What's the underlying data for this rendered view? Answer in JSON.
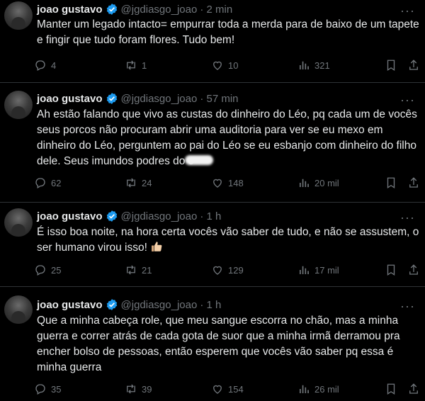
{
  "tweets": [
    {
      "name": "joao gustavo",
      "handle": "@jgdiasgo_joao",
      "time": "· 2 min",
      "text": "Manter um legado intacto= empurrar toda a merda para de baixo de um tapete e fingir que tudo foram flores. Tudo bem!",
      "text_tail": "",
      "replies": "4",
      "retweets": "1",
      "likes": "10",
      "views": "321"
    },
    {
      "name": "joao gustavo",
      "handle": "@jgdiasgo_joao",
      "time": "· 57 min",
      "text": "Ah estão falando que vivo as custas do dinheiro do Léo, pq cada um de vocês seus porcos não procuram abrir uma auditoria para ver se eu mexo em dinheiro do Léo, perguntem ao pai do Léo se eu esbanjo com dinheiro do filho dele. Seus imundos podres do c",
      "text_tail": "",
      "replies": "62",
      "retweets": "24",
      "likes": "148",
      "views": "20 mil"
    },
    {
      "name": "joao gustavo",
      "handle": "@jgdiasgo_joao",
      "time": "· 1 h",
      "text": "É isso boa noite, na hora certa vocês vão saber de tudo, e não se assustem, o ser humano virou isso! ",
      "text_tail": "",
      "replies": "25",
      "retweets": "21",
      "likes": "129",
      "views": "17 mil"
    },
    {
      "name": "joao gustavo",
      "handle": "@jgdiasgo_joao",
      "time": "· 1 h",
      "text": "Que a minha cabeça role, que meu sangue escorra no chão, mas a minha guerra e correr atrás de cada gota de suor que a minha irmã derramou pra encher bolso de pessoas, então esperem que vocês vão saber pq essa é minha guerra",
      "text_tail": "",
      "replies": "35",
      "retweets": "39",
      "likes": "154",
      "views": "26 mil"
    }
  ],
  "colors": {
    "background": "#000000",
    "text": "#e7e9ea",
    "muted": "#71767b",
    "verified": "#1d9bf0",
    "divider": "#2f3336"
  },
  "icons": [
    "avatar",
    "verified-badge-icon",
    "more-icon",
    "reply-icon",
    "retweet-icon",
    "like-icon",
    "views-icon",
    "bookmark-icon",
    "share-icon",
    "thumbs-up-emoji"
  ]
}
